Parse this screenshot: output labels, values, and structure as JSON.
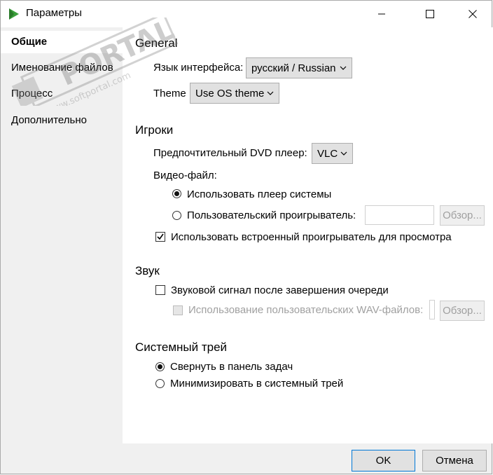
{
  "window": {
    "title": "Параметры"
  },
  "sidebar": {
    "items": [
      {
        "label": "Общие"
      },
      {
        "label": "Именование файлов"
      },
      {
        "label": "Процесс"
      },
      {
        "label": "Дополнительно"
      }
    ]
  },
  "general": {
    "title": "General",
    "language_label": "Язык интерфейса:",
    "language_value": "русский / Russian",
    "theme_label": "Theme",
    "theme_value": "Use OS theme"
  },
  "players": {
    "title": "Игроки",
    "dvd_label": "Предпочтительный DVD плеер:",
    "dvd_value": "VLC",
    "video_file_label": "Видео-файл:",
    "system_player_label": "Использовать плеер системы",
    "custom_player_label": "Пользовательский проигрыватель:",
    "custom_player_value": "",
    "browse_label": "Обзор...",
    "builtin_label": "Использовать встроенный проигрыватель для просмотра"
  },
  "sound": {
    "title": "Звук",
    "beep_label": "Звуковой сигнал после завершения очереди",
    "wav_label": "Использование пользовательских WAV-файлов:",
    "wav_value": "",
    "browse_label": "Обзор..."
  },
  "tray": {
    "title": "Системный трей",
    "taskbar_label": "Свернуть в панель задач",
    "tray_label": "Минимизировать в системный трей"
  },
  "footer": {
    "ok_label": "OK",
    "cancel_label": "Отмена"
  },
  "watermark": {
    "brand": "PORTAL",
    "url": "www.softportal.com"
  },
  "colors": {
    "app_icon_green": "#3a9e3a",
    "selected_radio": "#111111",
    "default_button_border": "#0078d7"
  }
}
